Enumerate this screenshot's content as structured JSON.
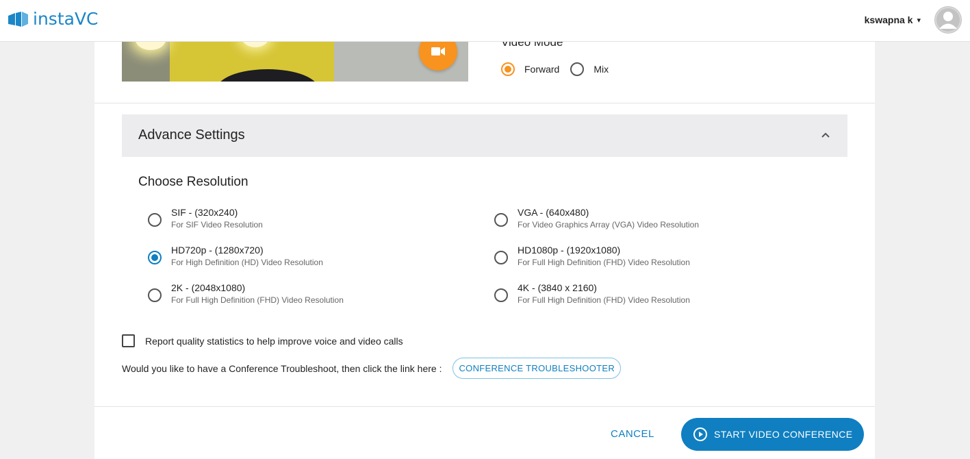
{
  "header": {
    "logo_text": "instaVC",
    "username": "kswapna k",
    "caret": "▾"
  },
  "video_mode": {
    "label": "Video Mode",
    "options": [
      {
        "label": "Forward",
        "selected": true
      },
      {
        "label": "Mix",
        "selected": false
      }
    ]
  },
  "advance_settings": {
    "title": "Advance Settings",
    "expanded": true
  },
  "resolution": {
    "title": "Choose Resolution",
    "options": [
      {
        "name": "SIF - (320x240)",
        "desc": "For SIF Video Resolution",
        "selected": false
      },
      {
        "name": "VGA - (640x480)",
        "desc": "For Video Graphics Array (VGA) Video Resolution",
        "selected": false
      },
      {
        "name": "HD720p - (1280x720)",
        "desc": "For High Definition (HD) Video Resolution",
        "selected": true
      },
      {
        "name": "HD1080p - (1920x1080)",
        "desc": "For Full High Definition (FHD) Video Resolution",
        "selected": false
      },
      {
        "name": "2K - (2048x1080)",
        "desc": "For Full High Definition (FHD) Video Resolution",
        "selected": false
      },
      {
        "name": "4K - (3840 x 2160)",
        "desc": "For Full High Definition (FHD) Video Resolution",
        "selected": false
      }
    ]
  },
  "report_stats": {
    "label": "Report quality statistics to help improve voice and video calls",
    "checked": false
  },
  "troubleshoot": {
    "text": "Would you like to have a Conference Troubleshoot, then click the link here :",
    "button_label": "CONFERENCE TROUBLESHOOTER"
  },
  "footer": {
    "cancel_label": "CANCEL",
    "start_label": "START VIDEO CONFERENCE"
  },
  "colors": {
    "brand_blue": "#0f7fc1",
    "accent_orange": "#f7931e"
  }
}
